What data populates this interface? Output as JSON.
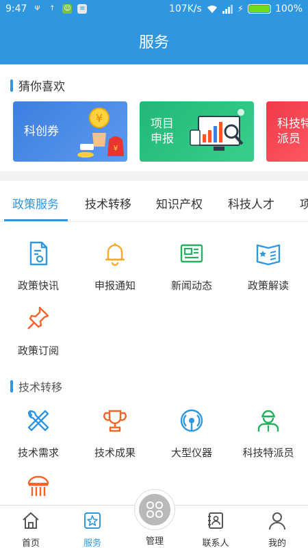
{
  "status_bar": {
    "time": "9:47",
    "network_speed": "107K/s",
    "battery_percent": "100%",
    "battery_level": 1.0
  },
  "header": {
    "title": "服务"
  },
  "guess": {
    "title": "猜你喜欢",
    "cards": [
      {
        "label_line1": "科创券",
        "label_line2": ""
      },
      {
        "label_line1": "项目",
        "label_line2": "申报"
      },
      {
        "label_line1": "科技特",
        "label_line2": "派员"
      }
    ]
  },
  "tabs": [
    "政策服务",
    "技术转移",
    "知识产权",
    "科技人才",
    "项"
  ],
  "policy_items": [
    "政策快讯",
    "申报通知",
    "新闻动态",
    "政策解读",
    "政策订阅"
  ],
  "tech_transfer": {
    "title": "技术转移",
    "items": [
      "技术需求",
      "技术成果",
      "大型仪器",
      "科技特派员"
    ]
  },
  "bottom_nav": [
    "首页",
    "服务",
    "管理",
    "联系人",
    "我的"
  ],
  "colors": {
    "primary": "#2f97df",
    "orange": "#f5622a",
    "yellow": "#f7a928",
    "green": "#27ae60"
  }
}
